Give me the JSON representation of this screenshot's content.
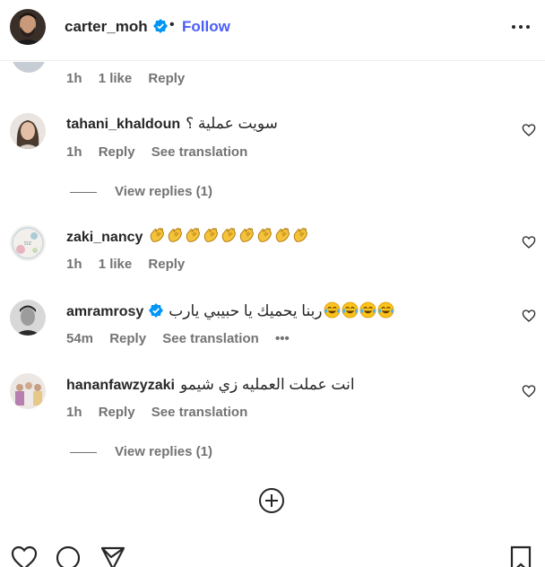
{
  "header": {
    "username": "carter_moh",
    "separator": "•",
    "follow_label": "Follow"
  },
  "top_meta": {
    "time": "1h",
    "likes": "1 like",
    "reply": "Reply"
  },
  "comments": [
    {
      "username": "tahani_khaldoun",
      "text": "سويت عملية ؟",
      "time": "1h",
      "reply": "Reply",
      "translation": "See translation"
    },
    {
      "username": "zaki_nancy",
      "text": "",
      "emoji": "clapping-hands-emoji",
      "emoji_count": 9,
      "time": "1h",
      "likes": "1 like",
      "reply": "Reply"
    },
    {
      "username": "amramrosy",
      "text": "ربنا يحميك يا حبيبي يارب",
      "emoji": "tears-of-joy-emoji",
      "emoji_count": 4,
      "time": "54m",
      "reply": "Reply",
      "translation": "See translation",
      "more": "•••"
    },
    {
      "username": "hananfawzyzaki",
      "text": "انت عملت العمليه زي شيمو",
      "time": "1h",
      "reply": "Reply",
      "translation": "See translation"
    }
  ],
  "view_replies": [
    "View replies (1)",
    "View replies (1)"
  ],
  "icons": {
    "verified": "verified-badge-icon",
    "more": "more-options-icon",
    "heart": "heart-outline-icon",
    "add": "add-comment-icon",
    "like": "like-icon",
    "comment": "comment-icon",
    "share": "share-icon",
    "save": "save-icon"
  },
  "colors": {
    "accent": "#4a5df9",
    "verified": "#0095f6",
    "muted": "#737373",
    "text": "#262626"
  }
}
